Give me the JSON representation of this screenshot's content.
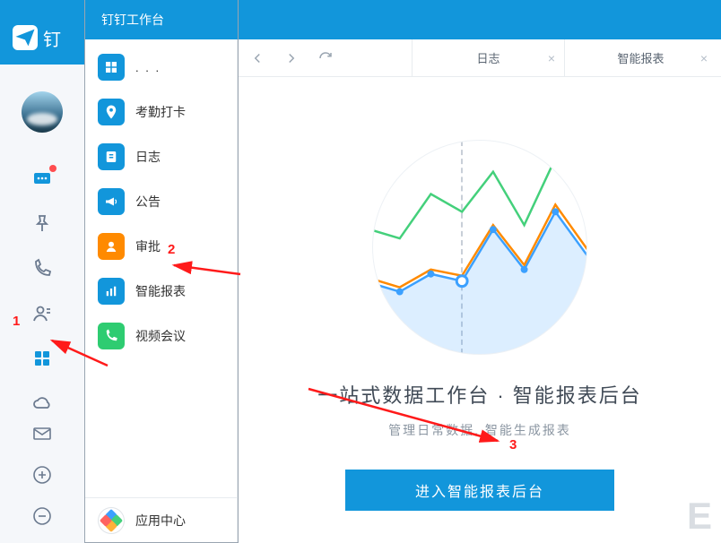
{
  "app": {
    "brand_text": "钉"
  },
  "panel": {
    "title": "钉钉工作台"
  },
  "applist": {
    "first": ". . .",
    "items": [
      {
        "label": "考勤打卡",
        "icon": "location-pin-icon",
        "color": "ic-blue"
      },
      {
        "label": "日志",
        "icon": "note-icon",
        "color": "ic-blue"
      },
      {
        "label": "公告",
        "icon": "megaphone-icon",
        "color": "ic-blue"
      },
      {
        "label": "审批",
        "icon": "user-check-icon",
        "color": "ic-orange"
      },
      {
        "label": "智能报表",
        "icon": "bar-chart-icon",
        "color": "ic-blue"
      },
      {
        "label": "视频会议",
        "icon": "phone-video-icon",
        "color": "ic-green"
      }
    ],
    "app_center": "应用中心"
  },
  "tabs": [
    {
      "label": "日志"
    },
    {
      "label": "智能报表"
    }
  ],
  "hero": {
    "title": "一站式数据工作台 · 智能报表后台",
    "subtitle": "管理日常数据, 智能生成报表",
    "cta": "进入智能报表后台"
  },
  "annotations": {
    "n1": "1",
    "n2": "2",
    "n3": "3"
  },
  "watermark": "E",
  "chart_data": {
    "type": "line",
    "title": "",
    "xlabel": "",
    "ylabel": "",
    "x": [
      0,
      1,
      2,
      3,
      4,
      5,
      6,
      7
    ],
    "series": [
      {
        "name": "green",
        "color": "#44d07b",
        "values": [
          120,
          100,
          150,
          130,
          175,
          120,
          185,
          165
        ]
      },
      {
        "name": "orange",
        "color": "#ff8a00",
        "values": [
          75,
          60,
          78,
          70,
          115,
          75,
          130,
          85
        ]
      },
      {
        "name": "blue",
        "color": "#3ba0ff",
        "values": [
          70,
          55,
          72,
          65,
          110,
          68,
          125,
          75
        ],
        "area": true,
        "markers": true
      }
    ],
    "ylim": [
      40,
      200
    ],
    "highlight_index": 3
  }
}
